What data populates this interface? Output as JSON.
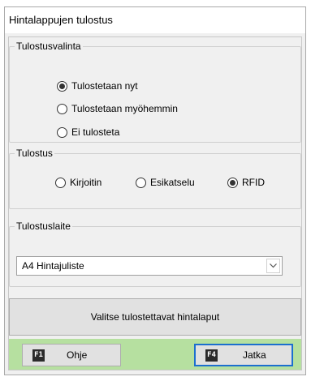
{
  "window": {
    "title": "Hintalappujen tulostus"
  },
  "print_choice": {
    "legend": "Tulostusvalinta",
    "options": [
      {
        "label": "Tulostetaan nyt",
        "checked": true
      },
      {
        "label": "Tulostetaan myöhemmin",
        "checked": false
      },
      {
        "label": "Ei tulosteta",
        "checked": false
      }
    ]
  },
  "print_mode": {
    "legend": "Tulostus",
    "options": [
      {
        "label": "Kirjoitin",
        "checked": false
      },
      {
        "label": "Esikatselu",
        "checked": false
      },
      {
        "label": "RFID",
        "checked": true
      }
    ]
  },
  "printer": {
    "legend": "Tulostuslaite",
    "selected": "A4 Hintajuliste"
  },
  "select_labels_button": "Valitse tulostettavat hintalaput",
  "footer": {
    "help": {
      "key": "F1",
      "label": "Ohje"
    },
    "continue": {
      "key": "F4",
      "label": "Jatka"
    }
  }
}
